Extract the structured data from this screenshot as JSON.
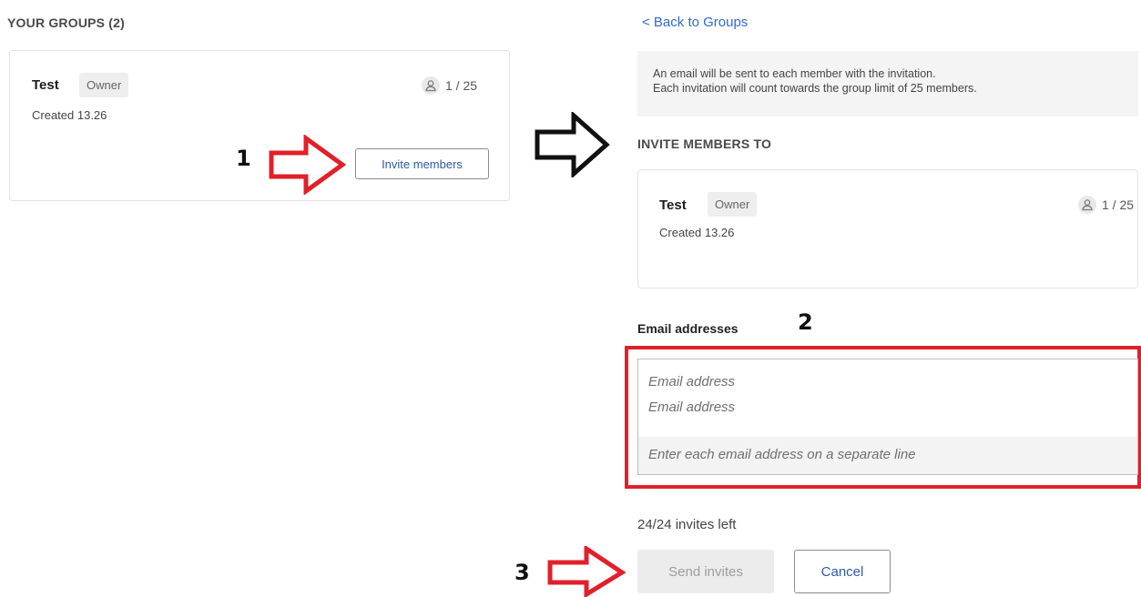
{
  "left": {
    "section_title": "YOUR GROUPS (2)",
    "group": {
      "name": "Test",
      "role": "Owner",
      "created": "Created 13.26",
      "member_count": "1 / 25",
      "invite_button": "Invite members"
    }
  },
  "right": {
    "back_link": "< Back to Groups",
    "info_line1": "An email will be sent to each member with the invitation.",
    "info_line2": "Each invitation will count towards the group limit of 25 members.",
    "invite_to_title": "INVITE MEMBERS TO",
    "group": {
      "name": "Test",
      "role": "Owner",
      "created": "Created 13.26",
      "member_count": "1 / 25"
    },
    "email_label": "Email addresses",
    "email_placeholder_1": "Email address",
    "email_placeholder_2": "Email address",
    "email_hint": "Enter each email address on a separate line",
    "invites_left": "24/24 invites left",
    "send_button": "Send invites",
    "cancel_button": "Cancel"
  },
  "annotations": {
    "step1": "1",
    "step2": "2",
    "step3": "3",
    "arrow_color_red": "#e0202a",
    "arrow_color_black": "#111111"
  },
  "icons": {
    "person": "person-icon",
    "arrow": "arrow-right-icon"
  }
}
